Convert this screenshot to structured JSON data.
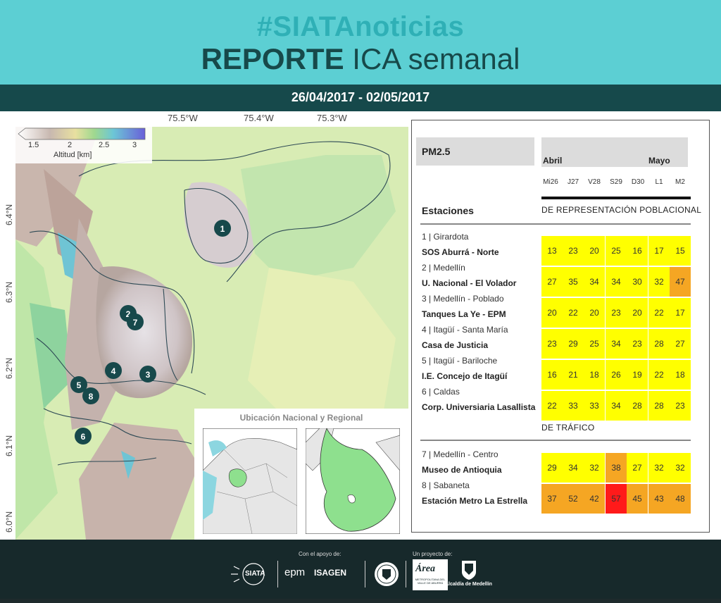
{
  "header": {
    "hashtag": "#SIATAnoticias",
    "title_bold": "REPORTE",
    "title_rest": " ICA semanal",
    "dates": "26/04/2017 - 02/05/2017"
  },
  "map": {
    "lon_labels": [
      "75.5°W",
      "75.4°W",
      "75.3°W"
    ],
    "lat_labels": [
      "6.4°N",
      "6.3°N",
      "6.2°N",
      "6.1°N",
      "6.0°N"
    ],
    "colorbar": {
      "ticks": [
        "1.5",
        "2",
        "2.5",
        "3"
      ],
      "label": "Altitud [km]"
    },
    "station_markers": [
      "1",
      "2",
      "7",
      "4",
      "3",
      "5",
      "8",
      "6"
    ],
    "inset_title": "Ubicación Nacional y Regional"
  },
  "table": {
    "pollutant": "PM2.5",
    "month_1": "Abril",
    "month_2": "Mayo",
    "days": [
      "Mi26",
      "J27",
      "V28",
      "S29",
      "D30",
      "L1",
      "M2"
    ],
    "stations_title": "Estaciones",
    "section_population": "DE REPRESENTACIÓN POBLACIONAL",
    "section_traffic": "DE TRÁFICO",
    "stations": [
      {
        "line1": "1 | Girardota",
        "line2": "SOS Aburrá - Norte",
        "values": [
          "13",
          "23",
          "20",
          "25",
          "16",
          "17",
          "15"
        ]
      },
      {
        "line1": "2 | Medellín",
        "line2": "U. Nacional - El Volador",
        "values": [
          "27",
          "35",
          "34",
          "34",
          "30",
          "32",
          "47"
        ]
      },
      {
        "line1": "3 | Medellín - Poblado",
        "line2": "Tanques La Ye - EPM",
        "values": [
          "20",
          "22",
          "20",
          "23",
          "20",
          "22",
          "17"
        ]
      },
      {
        "line1": "4 | Itagüí - Santa María",
        "line2": "Casa de Justicia",
        "values": [
          "23",
          "29",
          "25",
          "34",
          "23",
          "28",
          "27"
        ]
      },
      {
        "line1": "5 | Itagüí - Bariloche",
        "line2": "I.E. Concejo de Itagüí",
        "values": [
          "16",
          "21",
          "18",
          "26",
          "19",
          "22",
          "18"
        ]
      },
      {
        "line1": "6 | Caldas",
        "line2": "Corp. Universiaria Lasallista",
        "values": [
          "22",
          "33",
          "33",
          "34",
          "28",
          "28",
          "23"
        ]
      },
      {
        "line1": "7 | Medellín - Centro",
        "line2": "Museo de Antioquia",
        "values": [
          "29",
          "34",
          "32",
          "38",
          "27",
          "32",
          "32"
        ]
      },
      {
        "line1": "8 | Sabaneta",
        "line2": "Estación Metro La Estrella",
        "values": [
          "37",
          "52",
          "42",
          "57",
          "45",
          "43",
          "48"
        ]
      }
    ],
    "colors": {
      "good": "#ffff00",
      "moderate": "#f5a623",
      "bad": "#ff1a1a"
    }
  },
  "footer": {
    "support_label": "Con el apoyo de:",
    "project_label": "Un proyecto de:",
    "siata": "SIATA",
    "epm": "epm",
    "isagen": "ISAGEN",
    "area": "Área",
    "area_sub": "METROPOLITANA DEL VALLE DE ABURRÁ",
    "alcaldia": "Alcaldía de Medellín"
  }
}
